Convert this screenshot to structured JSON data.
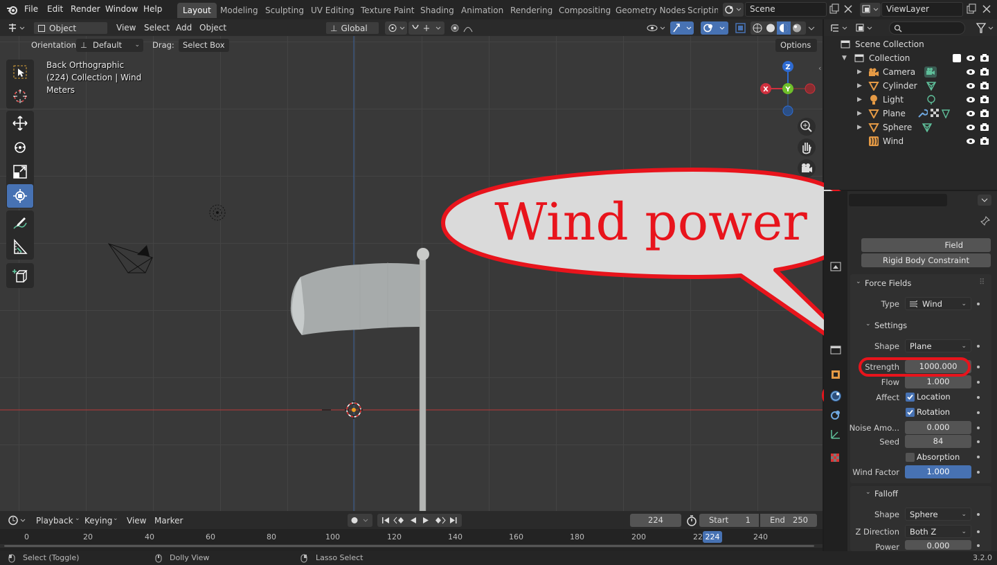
{
  "topbar": {
    "menus": [
      "File",
      "Edit",
      "Render",
      "Window",
      "Help"
    ],
    "workspaces": [
      "Layout",
      "Modeling",
      "Sculpting",
      "UV Editing",
      "Texture Paint",
      "Shading",
      "Animation",
      "Rendering",
      "Compositing",
      "Geometry Nodes",
      "Scripting"
    ],
    "scene": "Scene",
    "view_layer": "ViewLayer"
  },
  "viewport_header": {
    "mode": "Object Mode",
    "menus": [
      "View",
      "Select",
      "Add",
      "Object"
    ],
    "transform": "Global"
  },
  "tool_settings": {
    "orientation_label": "Orientation:",
    "orientation_value": "Default",
    "drag_label": "Drag:",
    "drag_value": "Select Box",
    "options": "Options"
  },
  "viewport": {
    "view_name": "Back Orthographic",
    "collection_info": "(224) Collection | Wind",
    "units": "Meters",
    "gizmo_axes": {
      "z": "Z",
      "y": "Y",
      "x": "X"
    }
  },
  "callout": {
    "text": "Wind power"
  },
  "timeline": {
    "menus": [
      "Playback",
      "Keying",
      "View",
      "Marker"
    ],
    "current_frame": "224",
    "start_label": "Start",
    "start": "1",
    "end_label": "End",
    "end": "250",
    "ticks": [
      "0",
      "20",
      "40",
      "60",
      "80",
      "100",
      "120",
      "140",
      "160",
      "180",
      "200",
      "22",
      "240"
    ],
    "playhead": "224"
  },
  "statusbar": {
    "select": "Select (Toggle)",
    "dolly": "Dolly View",
    "lasso": "Lasso Select",
    "version": "3.2.0"
  },
  "outliner": {
    "scene_collection": "Scene Collection",
    "collection": "Collection",
    "items": [
      {
        "name": "Camera"
      },
      {
        "name": "Cylinder"
      },
      {
        "name": "Light"
      },
      {
        "name": "Plane"
      },
      {
        "name": "Sphere"
      },
      {
        "name": "Wind"
      }
    ]
  },
  "properties": {
    "field_button": "Field",
    "rigid_body_constraint": "Rigid Body Constraint",
    "force_fields": "Force Fields",
    "type_label": "Type",
    "type_value": "Wind",
    "settings": "Settings",
    "shape_label": "Shape",
    "shape_value": "Plane",
    "strength_label": "Strength",
    "strength_value": "1000.000",
    "flow_label": "Flow",
    "flow_value": "1.000",
    "affect_label": "Affect",
    "location": "Location",
    "rotation": "Rotation",
    "noise_label": "Noise Amo...",
    "noise_value": "0.000",
    "seed_label": "Seed",
    "seed_value": "84",
    "absorption": "Absorption",
    "wind_factor_label": "Wind Factor",
    "wind_factor_value": "1.000",
    "falloff": "Falloff",
    "falloff_shape_label": "Shape",
    "falloff_shape_value": "Sphere",
    "z_direction_label": "Z Direction",
    "z_direction_value": "Both Z",
    "power_label": "Power",
    "power_value": "0.000"
  },
  "colors": {
    "accent": "#4772b3",
    "annotation": "#e8141c",
    "object_orange": "#e59a45",
    "data_green": "#5fbf9a"
  }
}
